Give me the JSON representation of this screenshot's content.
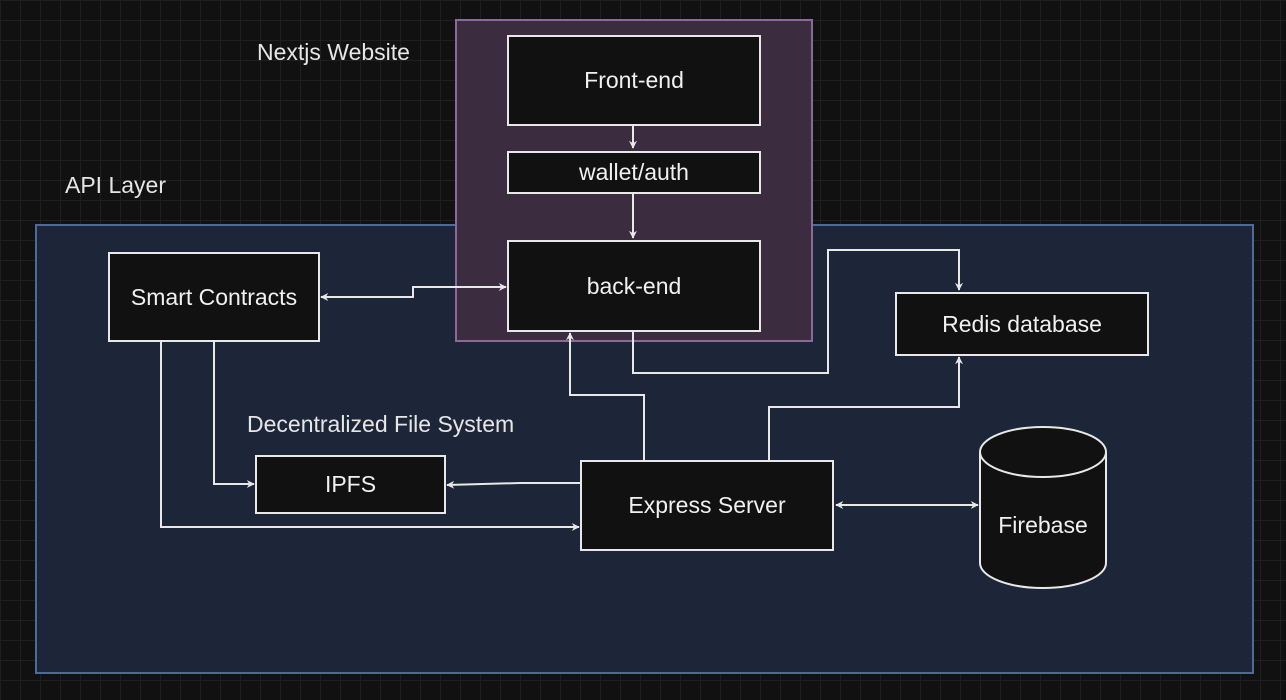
{
  "groups": {
    "api_layer": "API Layer",
    "nextjs": "Nextjs Website",
    "dfs": "Decentralized File System"
  },
  "nodes": {
    "frontend": "Front-end",
    "wallet": "wallet/auth",
    "backend": "back-end",
    "smart_contracts": "Smart Contracts",
    "redis": "Redis database",
    "ipfs": "IPFS",
    "express": "Express Server",
    "firebase": "Firebase"
  },
  "colors": {
    "background": "#111111",
    "api_fill": "#1d2639",
    "api_border": "#4f6a99",
    "nextjs_fill": "#3c2c40",
    "nextjs_border": "#8a6a98",
    "node_fill": "#111111",
    "stroke": "#e8e8e8"
  }
}
